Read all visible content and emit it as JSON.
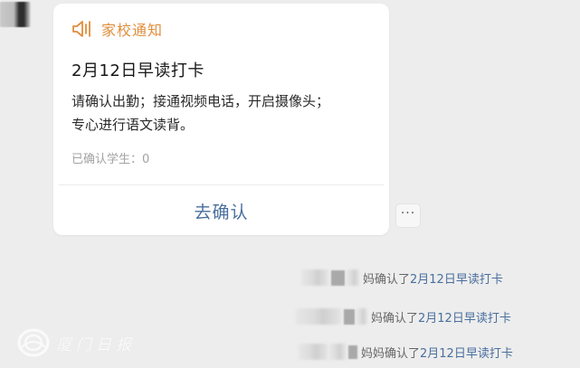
{
  "card": {
    "header_label": "家校通知",
    "title": "2月12日早读打卡",
    "body_line1": "请确认出勤；接通视频电话，开启摄像头；",
    "body_line2": "专心进行语文读背。",
    "confirmed_text": "已确认学生：0",
    "action_label": "去确认",
    "header_icon": "megaphone-icon"
  },
  "more_button": {
    "label": "···"
  },
  "system_messages": [
    {
      "prefix": "妈确认了",
      "link": "2月12日早读打卡"
    },
    {
      "prefix": "妈确认了",
      "link": "2月12日早读打卡"
    },
    {
      "prefix": "妈妈确认了",
      "link": "2月12日早读打卡"
    }
  ],
  "watermark": {
    "text": "厦门日报"
  },
  "colors": {
    "background": "#ededed",
    "card_accent": "#e08e3c",
    "link": "#4a6f9e",
    "muted": "#a3a3a3"
  }
}
